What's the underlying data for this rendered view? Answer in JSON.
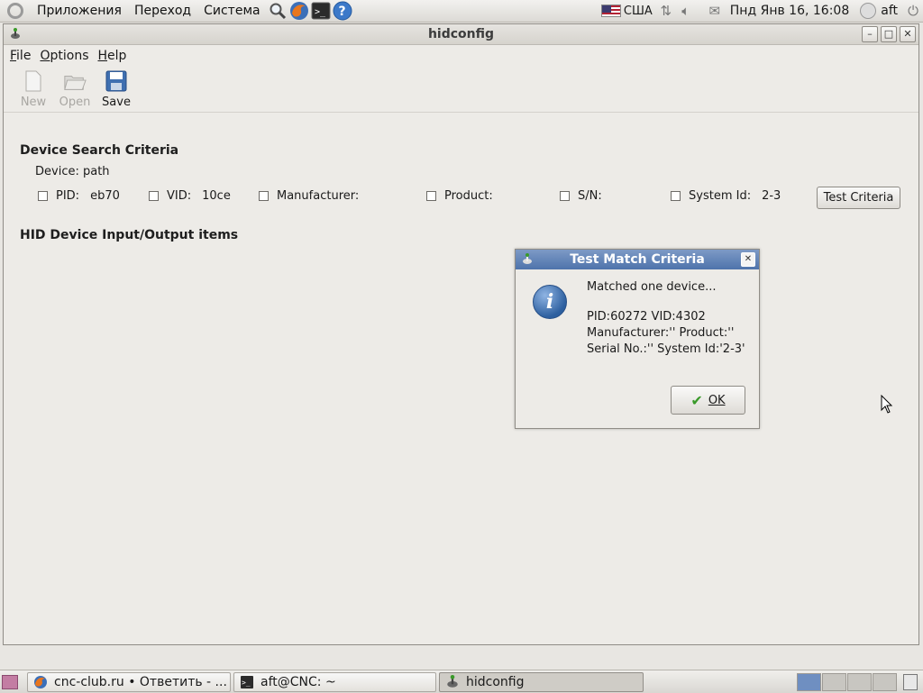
{
  "top_panel": {
    "menus": [
      "Приложения",
      "Переход",
      "Система"
    ],
    "launchers": [
      "search-icon",
      "firefox-icon",
      "terminal-icon",
      "help-icon"
    ],
    "keyboard_layout": "США",
    "clock": "Пнд Янв 16, 16:08",
    "user": "aft"
  },
  "window": {
    "title": "hidconfig",
    "menu": {
      "file": "File",
      "options": "Options",
      "help": "Help"
    },
    "toolbar": {
      "new": "New",
      "open": "Open",
      "save": "Save"
    },
    "search": {
      "heading": "Device Search Criteria",
      "device_label": "Device:",
      "device_value": "path",
      "pid_label": "PID:",
      "pid_value": "eb70",
      "vid_label": "VID:",
      "vid_value": "10ce",
      "manufacturer_label": "Manufacturer:",
      "product_label": "Product:",
      "sn_label": "S/N:",
      "system_id_label": "System Id:",
      "system_id_value": "2-3",
      "test_button": "Test Criteria"
    },
    "io_heading": "HID Device Input/Output items"
  },
  "dialog": {
    "title": "Test Match Criteria",
    "line1": "Matched one device...",
    "line2": "PID:60272 VID:4302",
    "line3": "Manufacturer:'' Product:''",
    "line4": "Serial No.:'' System Id:'2-3'",
    "ok": "OK"
  },
  "bottom_panel": {
    "tasks": [
      "cnc-club.ru • Ответить - ...",
      "aft@CNC: ~",
      "hidconfig"
    ],
    "active_task": "hidconfig"
  },
  "colors": {
    "dialog_title_bar": "#5b7fb6",
    "active_workspace": "#6f8fc1"
  }
}
